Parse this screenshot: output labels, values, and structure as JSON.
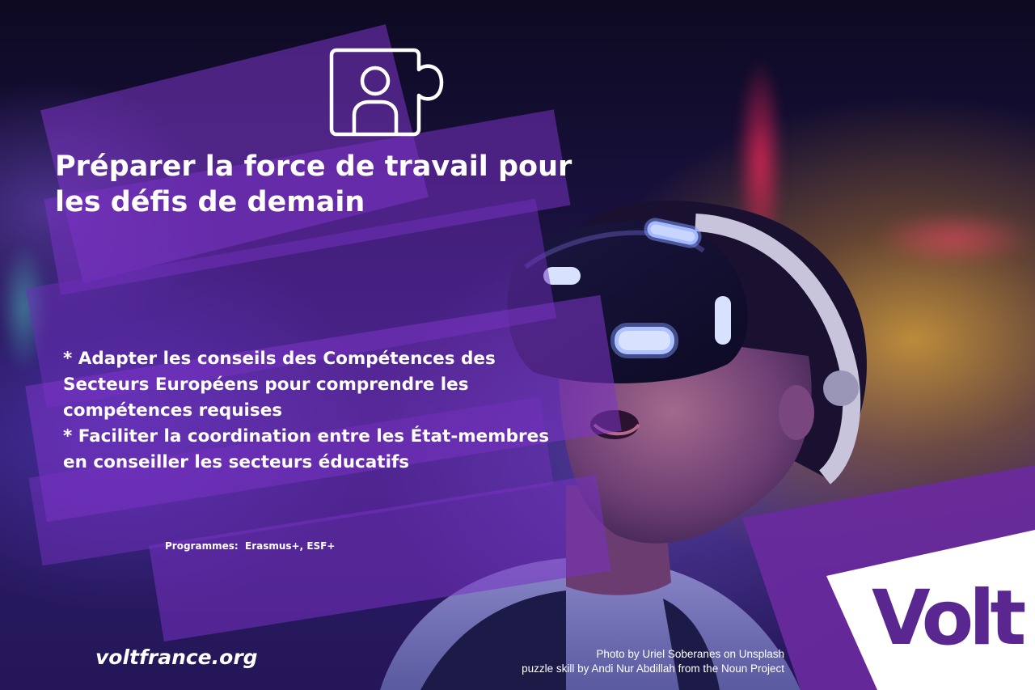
{
  "headline": {
    "line1": "Préparer la force de travail pour",
    "line2": "les défis de demain"
  },
  "bullets": [
    {
      "line1": "* Adapter les conseils des Compétences des",
      "line2": "Secteurs Européens pour comprendre les",
      "line3": "compétences requises"
    },
    {
      "line1": "* Faciliter la coordination entre les État-membres",
      "line2": "en conseiller les secteurs éducatifs"
    }
  ],
  "programmes": "Programmes:  Erasmus+, ESF+",
  "website": "voltfrance.org",
  "credits": {
    "photo": "Photo by Uriel Soberanes on Unsplash",
    "icon": "puzzle skill by Andi Nur Abdillah from the Noun Project"
  },
  "logo": {
    "text": "Volt",
    "color": "#5a2690"
  },
  "icon": "puzzle-person-icon",
  "colors": {
    "accent_purple": "#7a32be",
    "brand_purple": "#5a2690",
    "white": "#ffffff"
  }
}
